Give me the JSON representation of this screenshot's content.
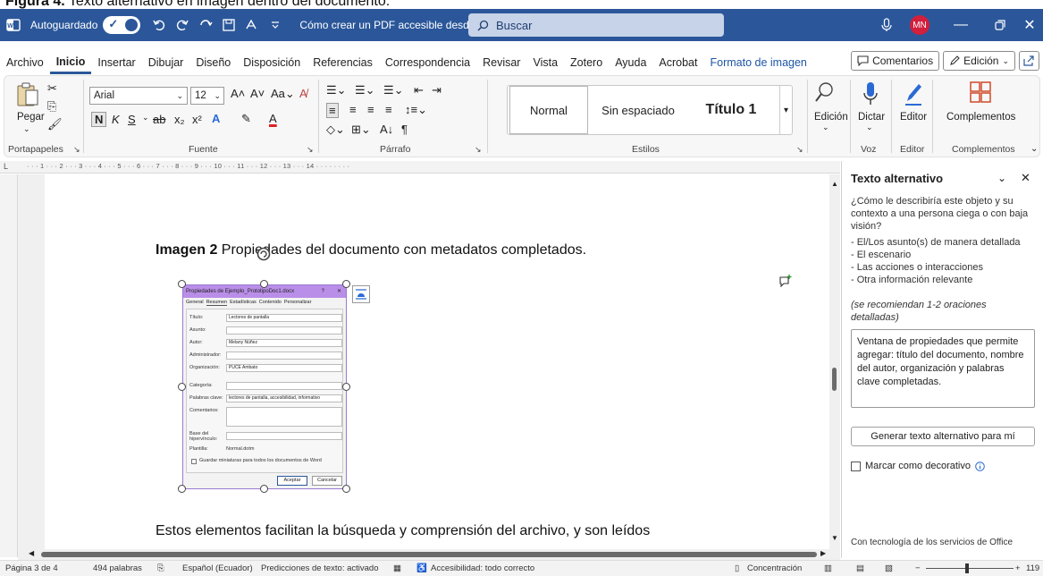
{
  "caption": {
    "bold": "Figura 4.",
    "rest": " Texto alternativo en imagen dentro del documento."
  },
  "titlebar": {
    "autosave_label": "Autoguardado",
    "doc_title": "Cómo crear un PDF accesible desde Microsoft Word....  • Guardando...",
    "search_placeholder": "Buscar",
    "avatar_initials": "MN"
  },
  "menu": {
    "tabs": [
      "Archivo",
      "Inicio",
      "Insertar",
      "Dibujar",
      "Diseño",
      "Disposición",
      "Referencias",
      "Correspondencia",
      "Revisar",
      "Vista",
      "Zotero",
      "Ayuda",
      "Acrobat",
      "Formato de imagen"
    ],
    "comments_label": "Comentarios",
    "edit_label": "Edición"
  },
  "ribbon": {
    "paste_label": "Pegar",
    "clipboard_group": "Portapapeles",
    "font_name": "Arial",
    "font_size": "12",
    "font_group": "Fuente",
    "paragraph_group": "Párrafo",
    "styles": [
      "Normal",
      "Sin espaciado",
      "Título 1"
    ],
    "styles_group": "Estilos",
    "edit_label": "Edición",
    "dictate_label": "Dictar",
    "voice_group": "Voz",
    "editor_label": "Editor",
    "editor_group": "Editor",
    "addins_label": "Complementos",
    "addins_group": "Complementos"
  },
  "ruler": {
    "numbers": "· · ·  1 · · · 2 · · · 3 · · · 4 · · · 5 · · · 6 · · · 7 · · · 8 · · · 9 · · · 10 · · · 11 · · · 12 · · · 13 · · · 14 · · · · · · · ·"
  },
  "document": {
    "caption_bold": "Imagen 2",
    "caption_rest": " Propiedades del documento con metadatos completados.",
    "body_text": "Estos elementos facilitan la búsqueda y comprensión del archivo, y son leídos"
  },
  "dialog": {
    "title": "Propiedades de Ejemplo_PrototipoDoc1.docx",
    "help": "?",
    "close": "✕",
    "tabs": [
      "General",
      "Resumen",
      "Estadísticas",
      "Contenido",
      "Personalizar"
    ],
    "fields": [
      {
        "label": "Título:",
        "value": "Lectores de pantalla"
      },
      {
        "label": "Asunto:",
        "value": ""
      },
      {
        "label": "Autor:",
        "value": "Melany Núñez"
      },
      {
        "label": "Administrador:",
        "value": ""
      },
      {
        "label": "Organización:",
        "value": "PUCE Ambato"
      },
      {
        "label": "Categoría:",
        "value": ""
      },
      {
        "label": "Palabras clave:",
        "value": "lectores de pantalla, accesibilidad, informativo"
      },
      {
        "label": "Comentarios:",
        "value": ""
      },
      {
        "label": "Base del hipervínculo:",
        "value": ""
      }
    ],
    "template_label": "Plantilla:",
    "template_value": "Normal.dotm",
    "thumbnail_label": "Guardar miniaturas para todos los documentos de Word",
    "ok_label": "Aceptar",
    "cancel_label": "Cancelar"
  },
  "pane": {
    "title": "Texto alternativo",
    "prompt": "¿Cómo le describiría este objeto y su contexto a una persona ciega o con baja visión?",
    "bullets": [
      "- El/Los asunto(s) de manera detallada",
      "- El escenario",
      "- Las acciones o interacciones",
      "- Otra información relevante"
    ],
    "recommend": "(se recomiendan 1-2 oraciones detalladas)",
    "alt_text": "Ventana de propiedades que permite agregar: título del documento, nombre del autor, organización y palabras clave completadas.",
    "generate_label": "Generar texto alternativo para mí",
    "decorative_label": "Marcar como decorativo",
    "footer": "Con tecnología de los servicios de Office"
  },
  "status": {
    "page": "Página 3 de 4",
    "words": "494 palabras",
    "language": "Español (Ecuador)",
    "predictions": "Predicciones de texto: activado",
    "accessibility": "Accesibilidad: todo correcto",
    "focus": "Concentración",
    "zoom": "119"
  },
  "colors": {
    "accent": "#2b579a",
    "avatar": "#d21f3c",
    "dialog_title": "#b98ee8"
  }
}
